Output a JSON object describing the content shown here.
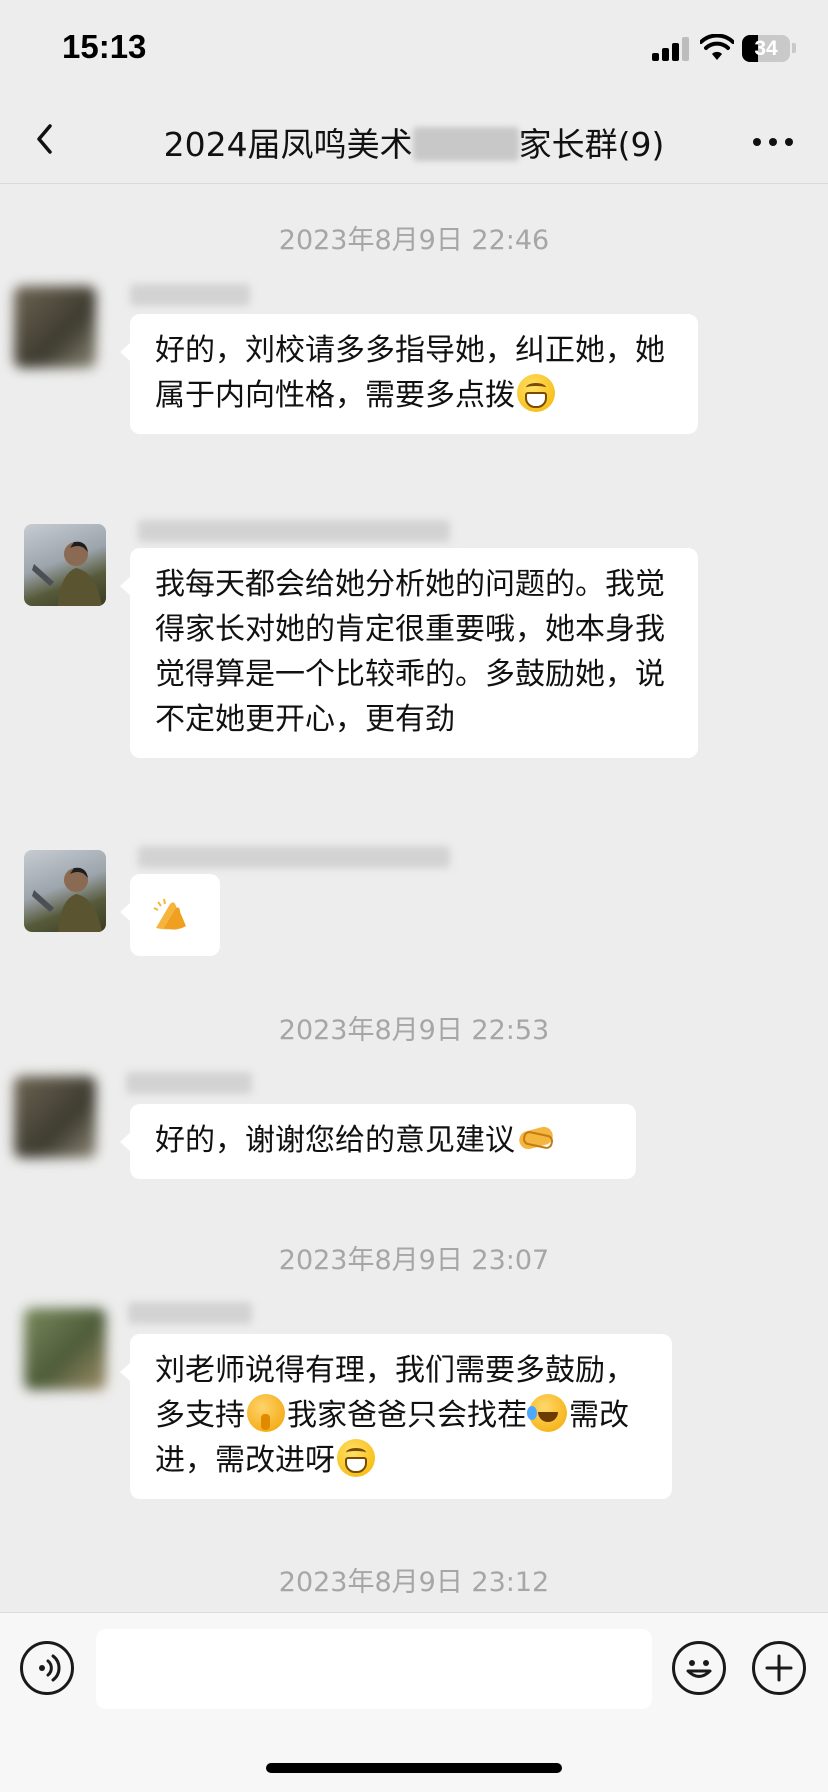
{
  "status_bar": {
    "time": "15:13",
    "battery_level": "34",
    "battery_fraction": 0.34
  },
  "nav": {
    "title_prefix": "2024届凤鸣美术",
    "title_suffix": "家长群(9)",
    "back_icon": "chevron-left-icon",
    "more_icon": "more-dots-icon"
  },
  "messages": [
    {
      "type": "timestamp",
      "text": "2023年8月9日 22:46"
    },
    {
      "type": "bubble",
      "sender": "parent-1",
      "text": "好的，刘校请多多指导她，纠正她，她属于内向性格，需要多点拨",
      "emoji_after": "grinning-face-emoji"
    },
    {
      "type": "bubble",
      "sender": "teacher",
      "text": "我每天都会给她分析她的问题的。我觉得家长对她的肯定很重要哦，她本身我觉得算是一个比较乖的。多鼓励她，说不定她更开心，更有劲"
    },
    {
      "type": "bubble",
      "sender": "teacher",
      "text": "",
      "emoji": "clapping-hands-emoji"
    },
    {
      "type": "timestamp",
      "text": "2023年8月9日 22:53"
    },
    {
      "type": "bubble",
      "sender": "parent-1",
      "text": "好的，谢谢您给的意见建议",
      "emoji_after": "handshake-emoji"
    },
    {
      "type": "timestamp",
      "text": "2023年8月9日 23:07"
    },
    {
      "type": "bubble",
      "sender": "parent-2",
      "text_parts": [
        "刘老师说得有理，我们需要多鼓励，多支持",
        "我家爸爸只会找茬",
        "需改进，需改进呀"
      ],
      "emojis": [
        "shushing-face-emoji",
        "laughing-crying-emoji",
        "grinning-face-emoji"
      ]
    },
    {
      "type": "timestamp",
      "text": "2023年8月9日 23:12"
    }
  ],
  "input_bar": {
    "voice_icon": "voice-icon",
    "emoji_icon": "emoji-icon",
    "plus_icon": "plus-icon",
    "placeholder": ""
  },
  "colors": {
    "background": "#ededed",
    "bubble": "#ffffff",
    "timestamp": "#a6a6a6"
  }
}
